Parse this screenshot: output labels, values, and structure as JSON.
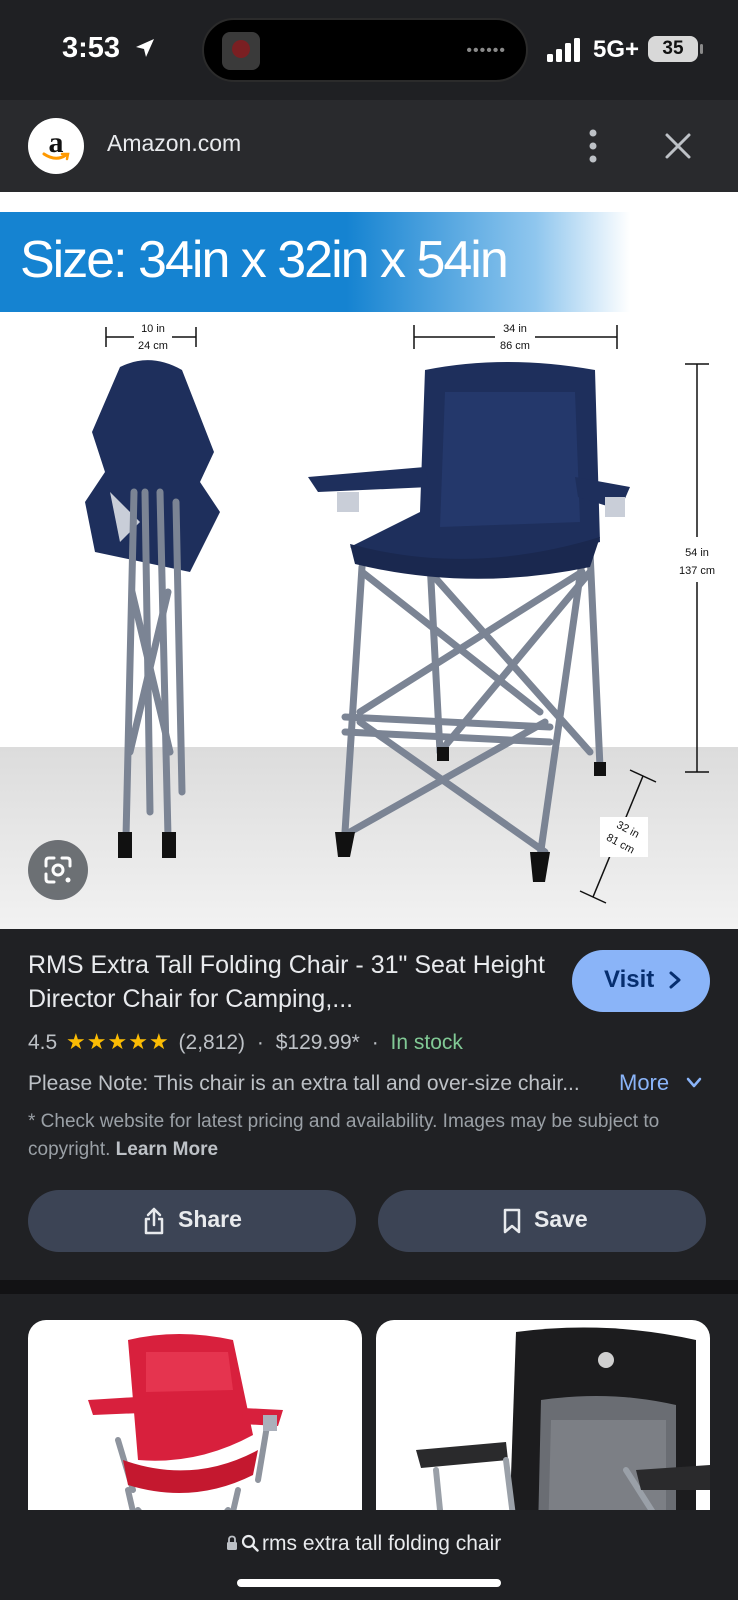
{
  "status_bar": {
    "time": "3:53",
    "carrier": "5G+",
    "battery": "35"
  },
  "site": {
    "logo_letter": "a",
    "title": "Amazon.com"
  },
  "image": {
    "banner": "Size: 34in x 32in x 54in",
    "dim_folded_in": "10 in",
    "dim_folded_cm": "24 cm",
    "dim_width_in": "34 in",
    "dim_width_cm": "86 cm",
    "dim_height_in": "54 in",
    "dim_height_cm": "137 cm",
    "dim_depth_in": "32 in",
    "dim_depth_cm": "81 cm"
  },
  "product": {
    "title": "RMS Extra Tall Folding Chair - 31\" Seat Height Director Chair for Camping,...",
    "rating": "4.5",
    "stars": "★★★★★",
    "reviews": "(2,812)",
    "price": "$129.99*",
    "availability": "In stock",
    "note": "Please Note: This chair is an extra tall and over-size chair...",
    "more_label": "More",
    "disclaimer": "* Check website for latest pricing and availability. Images may be subject to copyright.",
    "learn_more": "Learn More",
    "visit_label": "Visit"
  },
  "actions": {
    "share_label": "Share",
    "save_label": "Save"
  },
  "search": {
    "query": "rms extra tall folding chair"
  },
  "colors": {
    "accent": "#8ab4f8",
    "in_stock": "#81c995",
    "star": "#fbbc04",
    "banner_blue": "#1583d1",
    "chair_navy": "#1e2f5c"
  }
}
